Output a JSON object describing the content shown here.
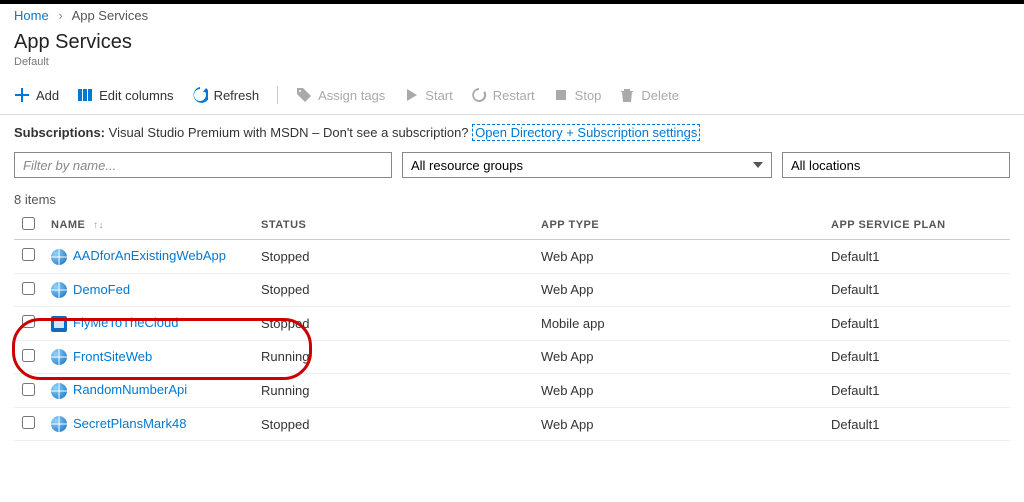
{
  "breadcrumb": {
    "home": "Home",
    "current": "App Services"
  },
  "page": {
    "title": "App Services",
    "subtitle": "Default"
  },
  "toolbar": {
    "add": "Add",
    "editColumns": "Edit columns",
    "refresh": "Refresh",
    "assignTags": "Assign tags",
    "start": "Start",
    "restart": "Restart",
    "stop": "Stop",
    "delete": "Delete"
  },
  "subscriptions": {
    "label": "Subscriptions:",
    "text": "Visual Studio Premium with MSDN – Don't see a subscription?",
    "link": "Open Directory + Subscription settings"
  },
  "filters": {
    "placeholder": "Filter by name...",
    "resourceGroups": "All resource groups",
    "locations": "All locations"
  },
  "count": "8 items",
  "columns": {
    "name": "NAME",
    "status": "STATUS",
    "appType": "APP TYPE",
    "plan": "APP SERVICE PLAN"
  },
  "rows": [
    {
      "name": "AADforAnExistingWebApp",
      "icon": "globe",
      "status": "Stopped",
      "type": "Web App",
      "plan": "Default1"
    },
    {
      "name": "DemoFed",
      "icon": "globe",
      "status": "Stopped",
      "type": "Web App",
      "plan": "Default1"
    },
    {
      "name": "FlyMeToTheCloud",
      "icon": "mobile",
      "status": "Stopped",
      "type": "Mobile app",
      "plan": "Default1"
    },
    {
      "name": "FrontSiteWeb",
      "icon": "globe",
      "status": "Running",
      "type": "Web App",
      "plan": "Default1"
    },
    {
      "name": "RandomNumberApi",
      "icon": "globe",
      "status": "Running",
      "type": "Web App",
      "plan": "Default1"
    },
    {
      "name": "SecretPlansMark48",
      "icon": "globe",
      "status": "Stopped",
      "type": "Web App",
      "plan": "Default1"
    }
  ]
}
